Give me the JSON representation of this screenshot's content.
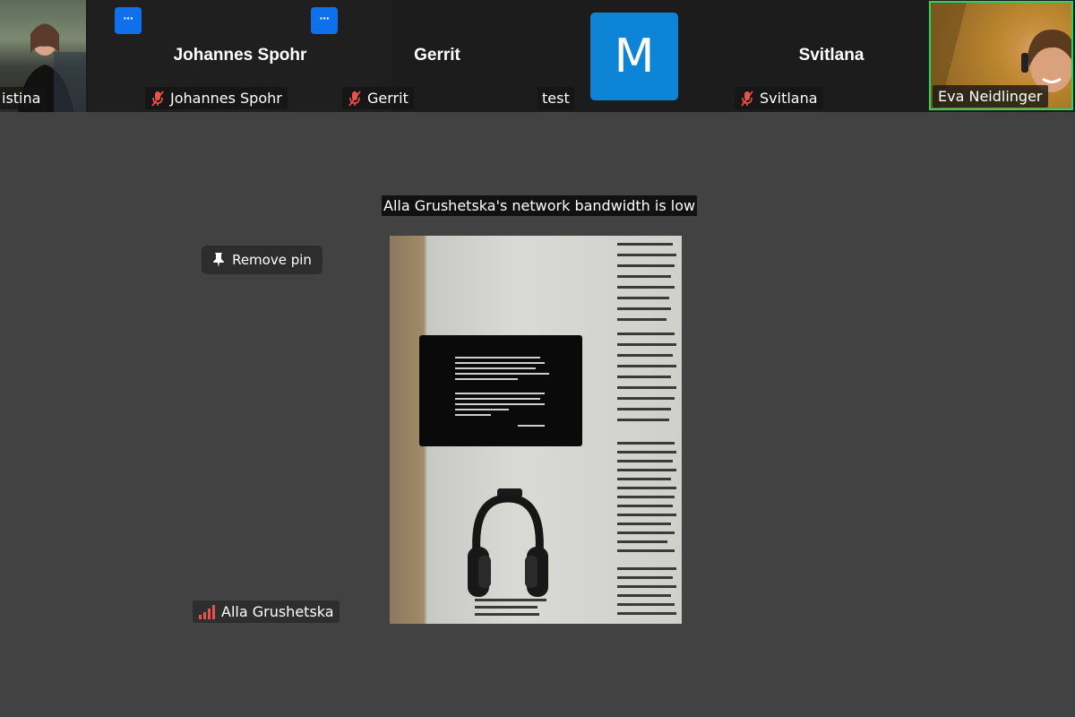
{
  "strip": {
    "tiles": [
      {
        "name": "Kristina",
        "label": "istina",
        "type": "video"
      },
      {
        "name": "Johannes Spohr",
        "label": "Johannes Spohr",
        "muted": true
      },
      {
        "name": "Gerrit",
        "label": "Gerrit",
        "muted": true
      },
      {
        "name": "test",
        "label": "test",
        "avatar_letter": "M",
        "muted": false
      },
      {
        "name": "Svitlana",
        "label": "Svitlana",
        "muted": true
      },
      {
        "name": "Eva Neidlinger",
        "label": "Eva Neidlinger",
        "type": "video",
        "active_speaker": true
      }
    ],
    "more_button_label": "···"
  },
  "main": {
    "network_banner": "Alla Grushetska's network bandwidth is low",
    "remove_pin_label": "Remove pin",
    "pinned_participant": "Alla Grushetska",
    "signal_icon": "low-signal-icon"
  },
  "colors": {
    "strip_background": "#1c1c1c",
    "stage_background": "#424242",
    "muted_icon": "#e8524a",
    "more_button": "#0e71eb",
    "avatar": "#0e84d6",
    "active_speaker_border": "#23d959"
  }
}
